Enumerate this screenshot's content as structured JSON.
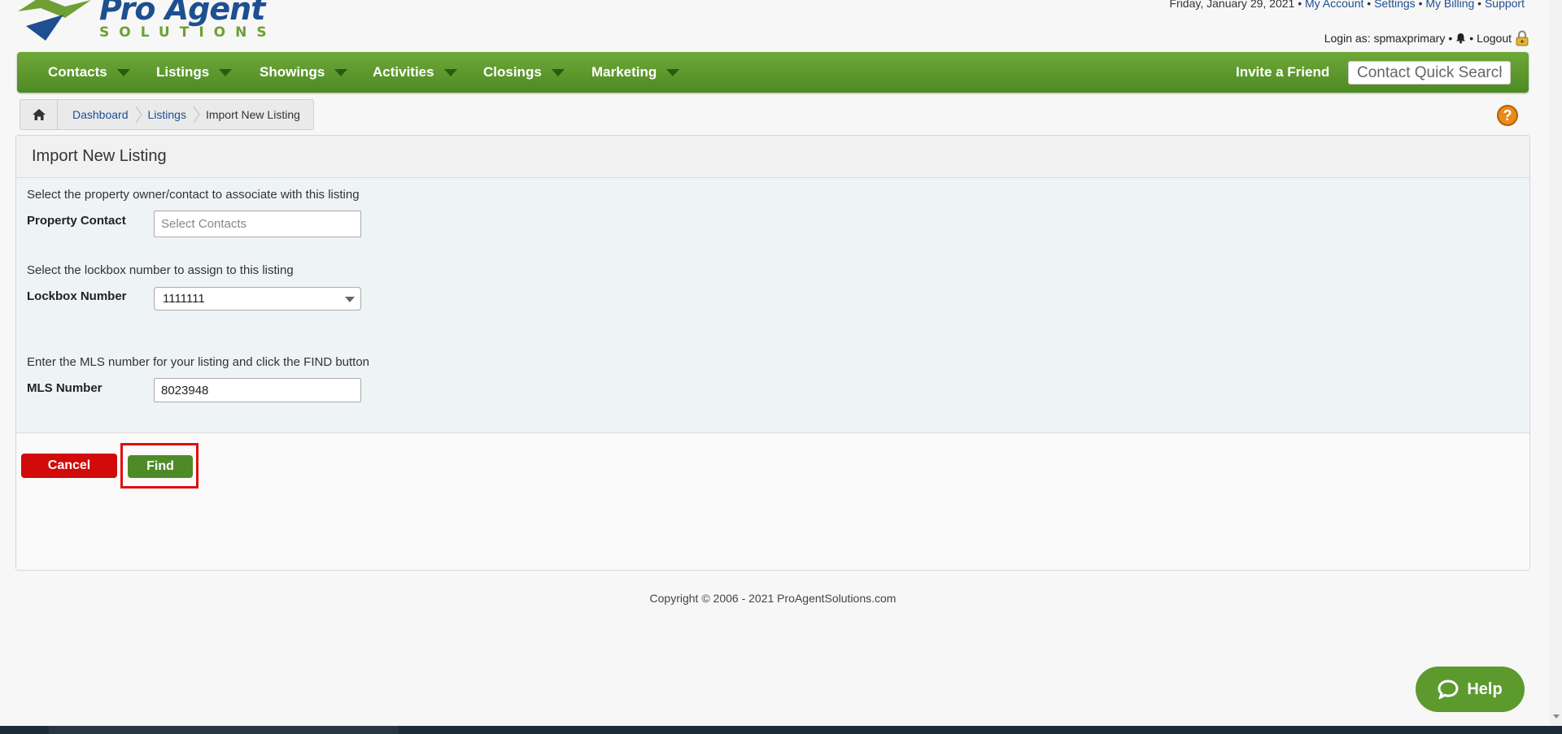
{
  "logo": {
    "line1": "Pro Agent",
    "line2": "SOLUTIONS"
  },
  "top_links": {
    "date": "Friday, January 29, 2021",
    "my_account": "My Account",
    "settings": "Settings",
    "my_billing": "My Billing",
    "support": "Support",
    "separator": "•"
  },
  "login": {
    "text": "Login as: spmaxprimary",
    "separator": "•",
    "logout": "Logout"
  },
  "nav": {
    "items": [
      {
        "label": "Contacts"
      },
      {
        "label": "Listings"
      },
      {
        "label": "Showings"
      },
      {
        "label": "Activities"
      },
      {
        "label": "Closings"
      },
      {
        "label": "Marketing"
      }
    ],
    "invite": "Invite a Friend",
    "search_placeholder": "Contact Quick Search"
  },
  "breadcrumb": {
    "items": [
      "Dashboard",
      "Listings",
      "Import New Listing"
    ]
  },
  "help_icon": "?",
  "panel": {
    "title": "Import New Listing",
    "contact_instr": "Select the property owner/contact to associate with this listing",
    "contact_label": "Property Contact",
    "contact_placeholder": "Select Contacts",
    "lockbox_instr": "Select the lockbox number to assign to this listing",
    "lockbox_label": "Lockbox Number",
    "lockbox_value": "1111111",
    "mls_instr": "Enter the MLS number for your listing and click the FIND button",
    "mls_label": "MLS Number",
    "mls_value": "8023948",
    "cancel": "Cancel",
    "find": "Find"
  },
  "footer": {
    "copyright": "Copyright © 2006 - 2021 ProAgentSolutions.com"
  },
  "help_widget": {
    "label": "Help"
  },
  "colors": {
    "nav_green": "#5c9a2e",
    "brand_blue": "#1d4f91",
    "cancel_red": "#d10a0a",
    "highlight_red": "#e01010"
  }
}
